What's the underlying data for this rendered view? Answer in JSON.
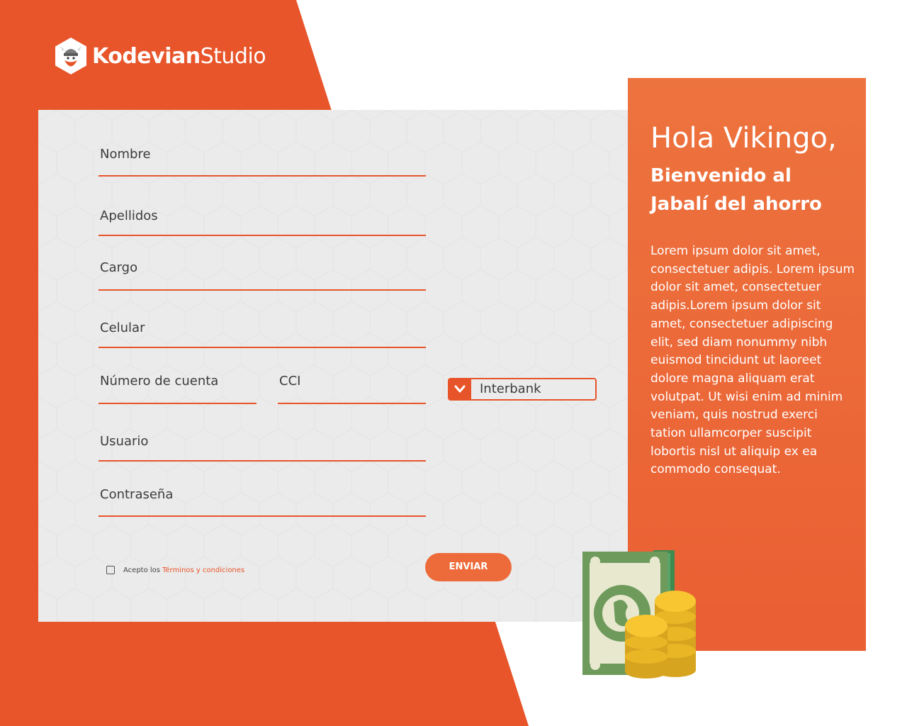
{
  "brand": {
    "name_bold": "Kodevian",
    "name_regular": "Studio",
    "logo_icon": "viking-logo-icon",
    "accent_color": "#e8542a"
  },
  "form": {
    "fields": [
      {
        "label": "Nombre"
      },
      {
        "label": "Apellidos"
      },
      {
        "label": "Cargo"
      },
      {
        "label": "Celular"
      },
      {
        "label": "Número de cuenta"
      },
      {
        "label": "CCI"
      },
      {
        "label": "Usuario"
      },
      {
        "label": "Contraseña"
      }
    ],
    "bank_select": {
      "value": "Interbank",
      "icon": "chevron-down-icon"
    },
    "terms": {
      "prefix": "Acepto los",
      "link": "Términos y condiciones",
      "checked": false
    },
    "submit_label": "ENVIAR"
  },
  "info": {
    "greeting": "Hola Vikingo,",
    "subtitle_line1": "Bienvenido al",
    "subtitle_line2": "Jabalí del ahorro",
    "body": "Lorem ipsum dolor sit amet, consectetuer adipis. Lorem ipsum dolor sit amet, consectetuer adipis.Lorem ipsum dolor sit amet, consectetuer adipiscing elit, sed diam nonummy nibh euismod tincidunt ut laoreet dolore magna aliquam erat volutpat. Ut wisi enim ad minim veniam, quis nostrud exerci tation ullamcorper suscipit lobortis nisl ut aliquip ex ea commodo consequat."
  },
  "illustration": {
    "icon": "money-and-coins-icon"
  }
}
